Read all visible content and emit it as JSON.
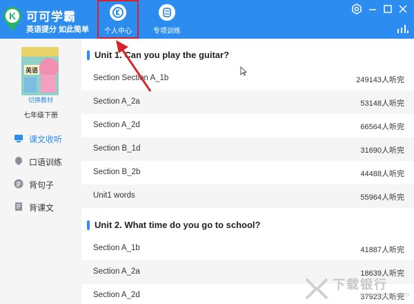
{
  "header": {
    "app_name": "可可学霸",
    "slogan": "英语提分 如此简单",
    "logo_letter": "K",
    "nav": [
      {
        "label": "个人中心",
        "icon": "user-center-icon",
        "highlighted": true
      },
      {
        "label": "专项训练",
        "icon": "special-training-icon"
      }
    ],
    "window_controls": [
      "settings-icon",
      "minimize-icon",
      "maximize-icon",
      "close-icon"
    ]
  },
  "sidebar": {
    "book_cover_text": "英语",
    "switch_label": "切换教材",
    "grade": "七年级下册",
    "menu": [
      {
        "label": "课文收听",
        "icon": "monitor-icon",
        "active": true
      },
      {
        "label": "口语训练",
        "icon": "mic-icon",
        "active": false
      },
      {
        "label": "背句子",
        "icon": "list-icon",
        "active": false
      },
      {
        "label": "背课文",
        "icon": "book-icon",
        "active": false
      }
    ]
  },
  "units": [
    {
      "title": "Unit 1. Can you play the guitar?",
      "sections": [
        {
          "name": "Section Section A_1b",
          "count": "249143人听完"
        },
        {
          "name": "Section A_2a",
          "count": "53148人听完"
        },
        {
          "name": "Section A_2d",
          "count": "66564人听完"
        },
        {
          "name": "Section B_1d",
          "count": "31690人听完"
        },
        {
          "name": "Section B_2b",
          "count": "44488人听完"
        },
        {
          "name": "Unit1 words",
          "count": "55964人听完"
        }
      ]
    },
    {
      "title": "Unit 2. What time do you go to school?",
      "sections": [
        {
          "name": "Section A_1b",
          "count": "41887人听完"
        },
        {
          "name": "Section A_2a",
          "count": "18639人听完"
        },
        {
          "name": "Section A_2d",
          "count": "37923人听完"
        }
      ]
    }
  ],
  "watermark": {
    "text": "下载银行",
    "url": "www.downcc.com"
  },
  "colors": {
    "primary": "#2c8cf0",
    "highlight": "#d8222a",
    "logo_green": "#27b36a",
    "row_alt": "#f5f5f5"
  }
}
